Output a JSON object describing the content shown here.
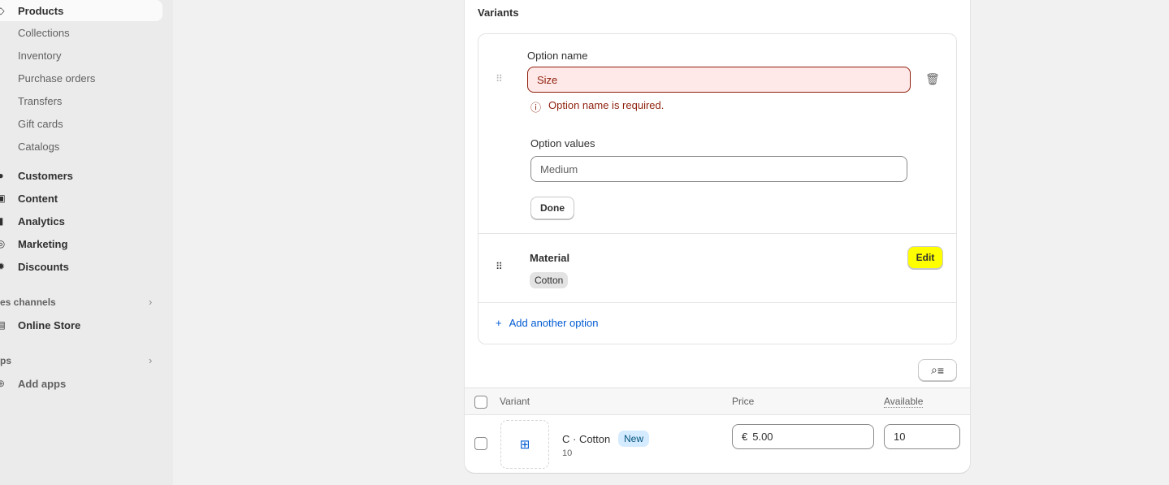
{
  "sidebar": {
    "items": [
      {
        "label": "Products",
        "icon": "tag-icon"
      },
      {
        "label": "Collections"
      },
      {
        "label": "Inventory"
      },
      {
        "label": "Purchase orders"
      },
      {
        "label": "Transfers"
      },
      {
        "label": "Gift cards"
      },
      {
        "label": "Catalogs"
      },
      {
        "label": "Customers",
        "icon": "person-icon"
      },
      {
        "label": "Content",
        "icon": "content-icon"
      },
      {
        "label": "Analytics",
        "icon": "bar-chart-icon"
      },
      {
        "label": "Marketing",
        "icon": "target-icon"
      },
      {
        "label": "Discounts",
        "icon": "discount-icon"
      }
    ],
    "sales_channels": "es channels",
    "online_store": "Online Store",
    "apps": "ps",
    "add_apps": "Add apps"
  },
  "variants": {
    "title": "Variants",
    "option_name_label": "Option name",
    "option_name_placeholder": "Size",
    "error": "Option name is required.",
    "option_values_label": "Option values",
    "option_values_placeholder": "Medium",
    "done": "Done",
    "material": {
      "name": "Material",
      "value": "Cotton",
      "edit": "Edit"
    },
    "add_option": "Add another option"
  },
  "table": {
    "headers": {
      "variant": "Variant",
      "price": "Price",
      "available": "Available"
    },
    "rows": [
      {
        "name": "C · Cotton",
        "badge": "New",
        "sub": "10",
        "currency": "€",
        "price": "5.00",
        "available": "10"
      }
    ]
  },
  "colors": {
    "error": "#8e1f0b",
    "error_bg": "#fee9e8",
    "link": "#005bd3",
    "highlight": "#ffff00"
  }
}
